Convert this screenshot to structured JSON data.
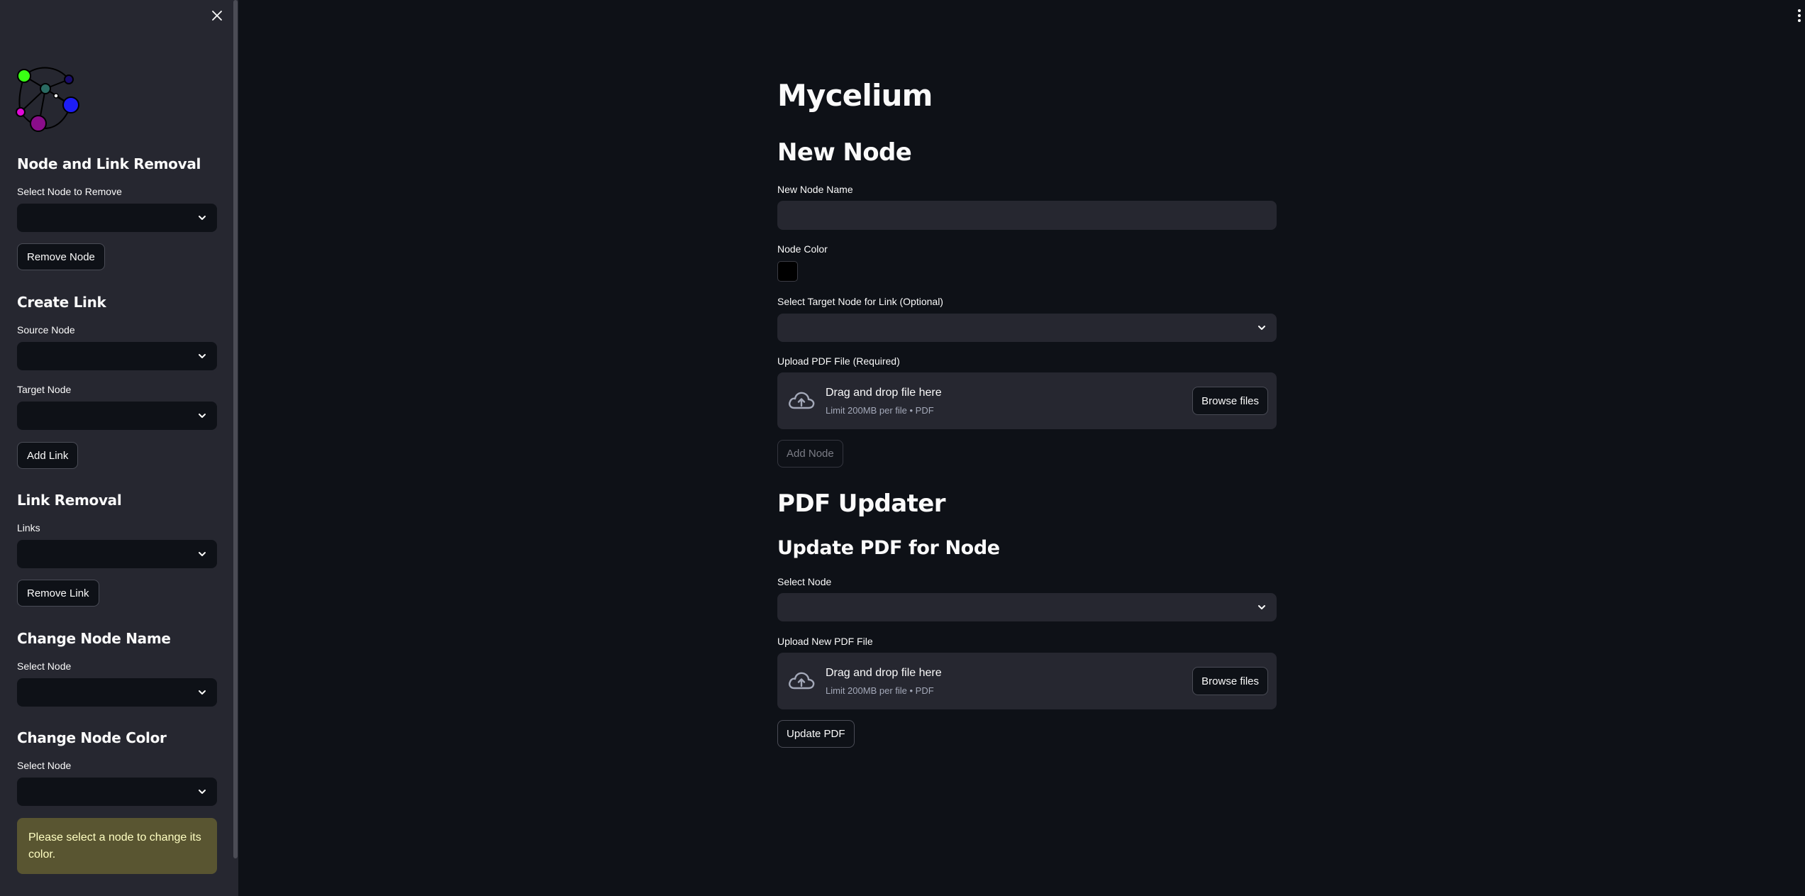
{
  "sidebar": {
    "removal": {
      "heading": "Node and Link Removal",
      "select_label": "Select Node to Remove",
      "select_value": "",
      "button": "Remove Node"
    },
    "create_link": {
      "heading": "Create Link",
      "source_label": "Source Node",
      "source_value": "",
      "target_label": "Target Node",
      "target_value": "",
      "button": "Add Link"
    },
    "link_removal": {
      "heading": "Link Removal",
      "links_label": "Links",
      "links_value": "",
      "button": "Remove Link"
    },
    "change_name": {
      "heading": "Change Node Name",
      "select_label": "Select Node",
      "select_value": ""
    },
    "change_color": {
      "heading": "Change Node Color",
      "select_label": "Select Node",
      "select_value": "",
      "warning": "Please select a node to change its color."
    },
    "logo_colors": [
      "#39ff14",
      "#2a6b63",
      "#e00ad8",
      "#1a0d6e",
      "#1d1df5",
      "#8a0d8a"
    ]
  },
  "main": {
    "title": "Mycelium",
    "new_node": {
      "heading": "New Node",
      "name_label": "New Node Name",
      "name_value": "",
      "color_label": "Node Color",
      "color_value": "#000000",
      "target_label": "Select Target Node for Link (Optional)",
      "target_value": "",
      "upload_label": "Upload PDF File (Required)",
      "upload_title": "Drag and drop file here",
      "upload_sub": "Limit 200MB per file • PDF",
      "browse": "Browse files",
      "add_button": "Add Node"
    },
    "pdf_updater": {
      "heading": "PDF Updater",
      "subheading": "Update PDF for Node",
      "select_label": "Select Node",
      "select_value": "",
      "upload_label": "Upload New PDF File",
      "upload_title": "Drag and drop file here",
      "upload_sub": "Limit 200MB per file • PDF",
      "browse": "Browse files",
      "update_button": "Update PDF"
    }
  },
  "colors": {
    "background": "#0e1117",
    "sidebar": "#262730",
    "widget": "#262730",
    "warning_bg": "#595531",
    "warning_text": "#ffffc2"
  }
}
